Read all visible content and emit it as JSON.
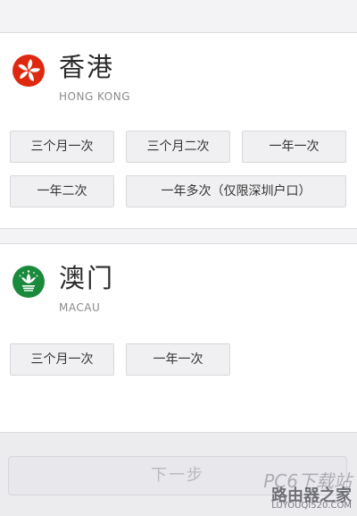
{
  "hong_kong": {
    "name": "香港",
    "subtitle": "HONG KONG",
    "flag_icon": "hong-kong-flag-icon",
    "flag_color": "#de2910",
    "options": [
      "三个月一次",
      "三个月二次",
      "一年一次",
      "一年二次",
      "一年多次（仅限深圳户口）"
    ]
  },
  "macau": {
    "name": "澳门",
    "subtitle": "MACAU",
    "flag_icon": "macau-flag-icon",
    "flag_color": "#1a8a3c",
    "options": [
      "三个月一次",
      "一年一次"
    ]
  },
  "footer": {
    "next_label": "下一步"
  },
  "watermark": {
    "line1": "PC6下载站",
    "line2": "路由器之家",
    "line3": "LUYOUQI520.COM"
  }
}
